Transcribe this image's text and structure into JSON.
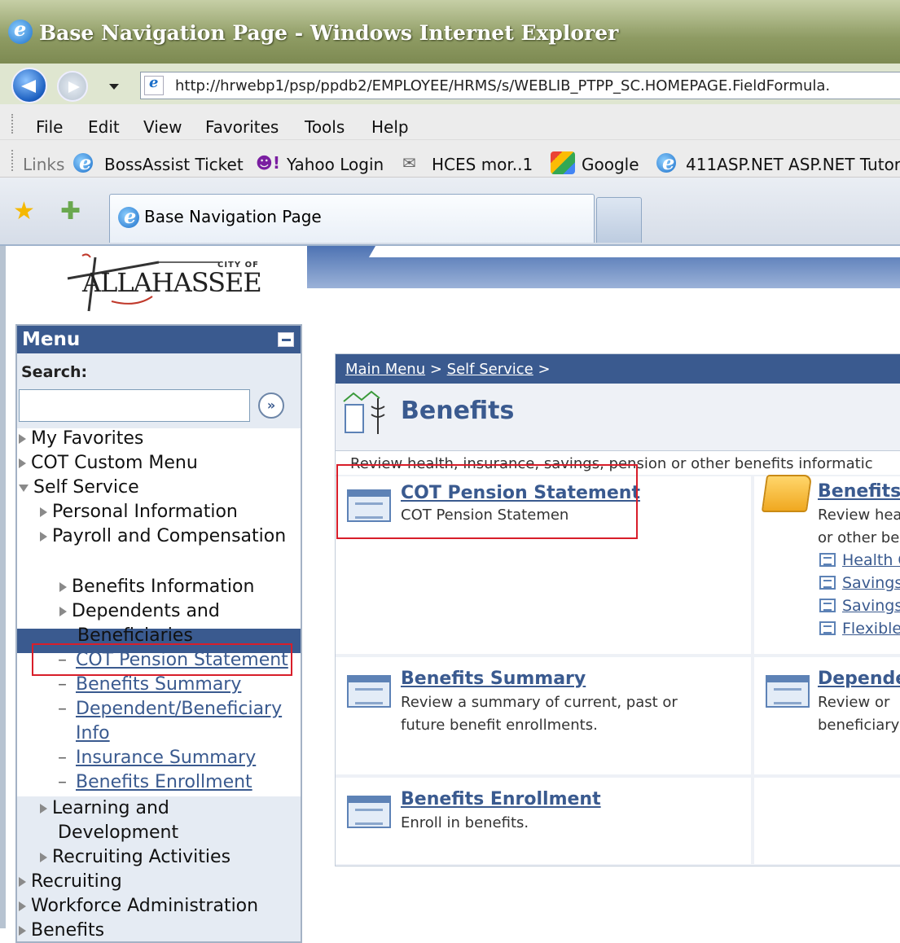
{
  "browser": {
    "window_title": "Base Navigation Page - Windows Internet Explorer",
    "url": "http://hrwebp1/psp/ppdb2/EMPLOYEE/HRMS/s/WEBLIB_PTPP_SC.HOMEPAGE.FieldFormula.",
    "menus": [
      "File",
      "Edit",
      "View",
      "Favorites",
      "Tools",
      "Help"
    ],
    "links_label": "Links",
    "links": [
      "BossAssist Ticket",
      "Yahoo Login",
      "HCES mor..1",
      "Google",
      "411ASP.NET ASP.NET Tutor"
    ],
    "tab_title": "Base Navigation Page"
  },
  "logo": {
    "city_of": "CITY OF",
    "name": "ALLAHASSEE"
  },
  "menu": {
    "title": "Menu",
    "search_label": "Search:",
    "go": "»",
    "items": [
      "My Favorites",
      "COT Custom Menu",
      "Self Service",
      "Personal Information",
      "Payroll and Compensation",
      "Benefits",
      "Benefits Information",
      "Dependents and",
      "Beneficiaries",
      "COT Pension Statement",
      "Benefits Summary",
      "Dependent/Beneficiary",
      "Info",
      "Insurance Summary",
      "Benefits Enrollment",
      "Learning and",
      "Development",
      "Recruiting Activities",
      "Recruiting",
      "Workforce Administration",
      "Benefits"
    ]
  },
  "main": {
    "breadcrumb": {
      "main_menu": "Main Menu",
      "sep1": " > ",
      "self_service": "Self Service",
      "sep2": " >"
    },
    "title": "Benefits",
    "description": "Review health, insurance, savings, pension or other benefits informatic",
    "cells": {
      "pension": {
        "title": "COT Pension Statement",
        "desc": "COT Pension Statemen"
      },
      "benefits_info": {
        "title": "Benefits I",
        "desc1": "Review hea",
        "desc2": "or other ber",
        "sublinks": [
          "Health C",
          "Savings",
          "Savings",
          "Flexible"
        ]
      },
      "summary": {
        "title": "Benefits Summary",
        "desc1": "Review a summary of current, past or",
        "desc2": "future benefit enrollments."
      },
      "dependents": {
        "title": "Depender",
        "desc1": "Review or",
        "desc2": "beneficiary"
      },
      "enrollment": {
        "title": "Benefits Enrollment",
        "desc": "Enroll in benefits."
      }
    }
  },
  "colors": {
    "accent": "#3a5a8f",
    "highlight_box": "#d81e2a"
  }
}
